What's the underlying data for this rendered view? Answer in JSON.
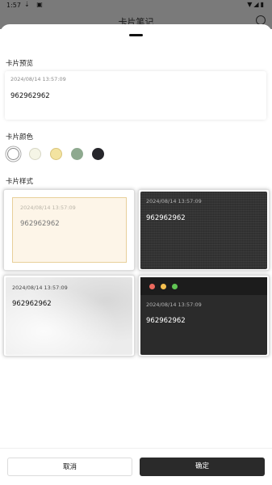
{
  "status_bar": {
    "time": "1:57",
    "left_icons": "⇣ ▣",
    "right_icons": "▼◢▮"
  },
  "header": {
    "title": "卡片笔记"
  },
  "sections": {
    "preview_label": "卡片预览",
    "color_label": "卡片颜色",
    "style_label": "卡片样式"
  },
  "preview": {
    "timestamp": "2024/08/14 13:57:09",
    "text": "962962962"
  },
  "colors": [
    {
      "name": "white",
      "hex": "#ffffff",
      "selected": true
    },
    {
      "name": "cream",
      "hex": "#f5f5e6"
    },
    {
      "name": "yellow",
      "hex": "#f3e3a0"
    },
    {
      "name": "green",
      "hex": "#8ea98f"
    },
    {
      "name": "black",
      "hex": "#26262b"
    }
  ],
  "styles": [
    {
      "timestamp": "2024/08/14 13:57:09",
      "text": "962962962"
    },
    {
      "timestamp": "2024/08/14 13:57:09",
      "text": "962962962"
    },
    {
      "timestamp": "2024/08/14 13:57:09",
      "text": "962962962"
    },
    {
      "timestamp": "2024/08/14 13:57:09",
      "text": "962962962",
      "dots": [
        "#ec6a5e",
        "#f4bf4f",
        "#61c554"
      ]
    }
  ],
  "buttons": {
    "cancel": "取消",
    "confirm": "确定"
  }
}
